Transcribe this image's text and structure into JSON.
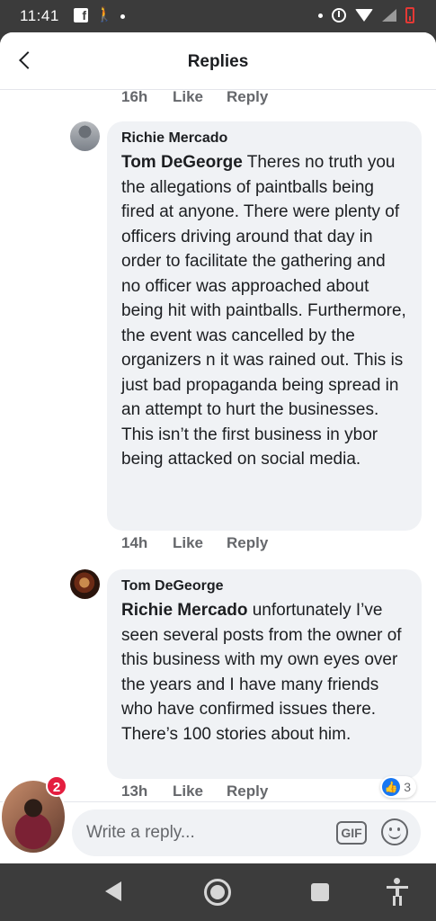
{
  "status_bar": {
    "time": "11:41",
    "icons": [
      "facebook-notification-icon",
      "walk-icon",
      "dot-icon",
      "dot-icon",
      "data-saver-icon",
      "wifi-icon",
      "signal-icon",
      "battery-low-icon"
    ]
  },
  "header": {
    "title": "Replies",
    "back_icon": "back-arrow-icon"
  },
  "comments": [
    {
      "time": "16h",
      "like": "Like",
      "reply": "Reply"
    },
    {
      "author": "Richie Mercado",
      "mention": "Tom DeGeorge",
      "text": " Theres no truth you the allegations of paintballs being fired at anyone. There were plenty of officers driving around that day in order to facilitate the gathering and no officer was approached about being hit with paintballs. Furthermore, the event was cancelled by the organizers n it was rained out. This is just bad propaganda being spread in an attempt to hurt the businesses. This isn’t the first business in ybor being attacked on social media.",
      "time": "14h",
      "like": "Like",
      "reply": "Reply"
    },
    {
      "author": "Tom DeGeorge",
      "mention": "Richie Mercado",
      "text": " unfortunately I’ve seen several posts from the owner of this business with my own eyes over the years and I have many friends who have confirmed issues there. There’s 100 stories about him.",
      "time": "13h",
      "like": "Like",
      "reply": "Reply",
      "reaction_count": "3"
    }
  ],
  "composer": {
    "placeholder": "Write a reply...",
    "gif_label": "GIF"
  },
  "chat_head": {
    "badge": "2"
  },
  "colors": {
    "accent": "#1877f2",
    "badge": "#e41e3f",
    "bubble": "#f0f2f5",
    "meta_text": "#65676b"
  }
}
